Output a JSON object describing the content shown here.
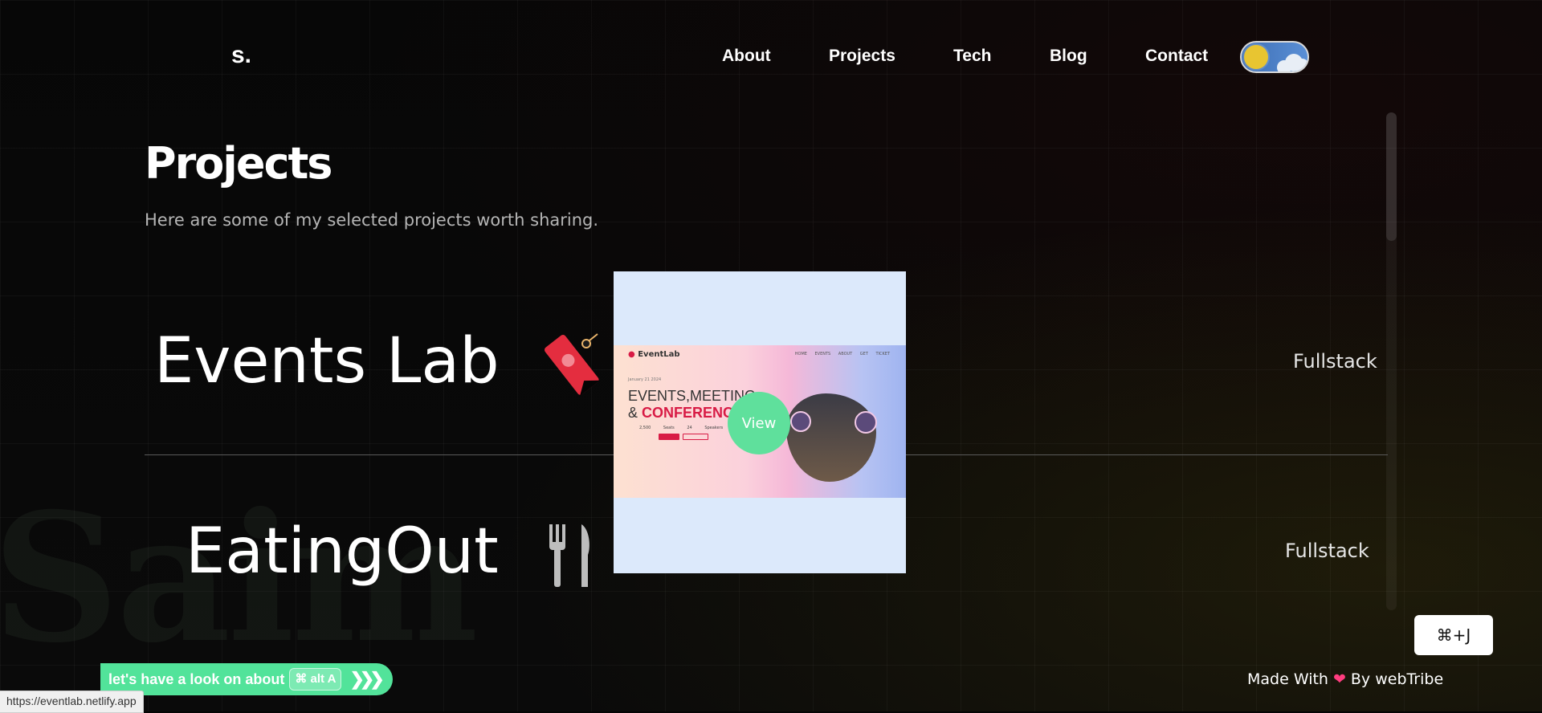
{
  "header": {
    "logo": "s.",
    "nav": [
      {
        "label": "About",
        "name": "nav-about"
      },
      {
        "label": "Projects",
        "name": "nav-projects"
      },
      {
        "label": "Tech",
        "name": "nav-tech"
      },
      {
        "label": "Blog",
        "name": "nav-blog"
      },
      {
        "label": "Contact",
        "name": "nav-contact"
      }
    ],
    "theme_toggle_icon": "sun-cloud-toggle-icon"
  },
  "page": {
    "title": "Projects",
    "subtitle": "Here are some of my selected projects worth sharing.",
    "background_word": "Saim"
  },
  "projects": [
    {
      "title": "Events Lab",
      "icon": "ticket-icon",
      "tag": "Fullstack"
    },
    {
      "title": "EatingOut",
      "icon": "fork-knife-icon",
      "tag": "Fullstack"
    }
  ],
  "preview": {
    "view_label": "View",
    "site": {
      "brand": "EventLab",
      "nav": "HOME EVENTS ABOUT GET TICKET",
      "headline_1": "EVENTS,MEETING",
      "headline_2_prefix": "& ",
      "headline_2_accent": "CONFERENCE",
      "date": "January 21 2024",
      "stats": "2,500 Seats 24 Speakers 12 Workshops",
      "accent": "#d81b45"
    }
  },
  "status_url": "https://eventlab.netlify.app",
  "toast": {
    "text": "let's have a look on about",
    "shortcut": "⌘ alt A",
    "arrows": "❯❯❯"
  },
  "shortcut_button": "⌘+J",
  "footer": {
    "made_with": "Made With",
    "heart": "❤",
    "by": "By webTribe"
  },
  "colors": {
    "accent_green": "#52e39a",
    "toggle_sun": "#e8c531",
    "heart": "#ff3d7f"
  }
}
